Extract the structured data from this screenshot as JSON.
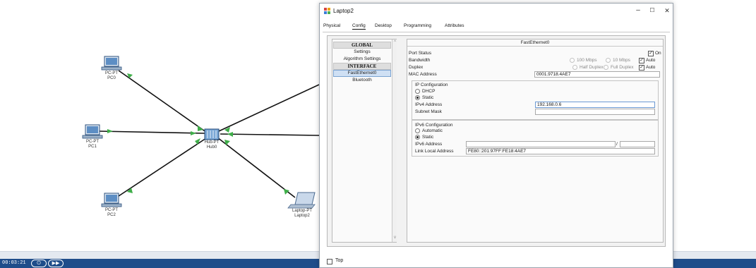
{
  "topology": {
    "devices": [
      {
        "id": "pc0",
        "type": "PC-PT",
        "name": "PC0"
      },
      {
        "id": "pc1",
        "type": "PC-PT",
        "name": "PC1"
      },
      {
        "id": "pc2",
        "type": "PC-PT",
        "name": "PC2"
      },
      {
        "id": "hub0",
        "type": "Hub-PT",
        "name": "Hub0"
      },
      {
        "id": "laptop2",
        "type": "Laptop-PT",
        "name": "Laptop2"
      }
    ],
    "link_color": "#111111",
    "link_light_color": "#3fae49"
  },
  "simbar": {
    "time": "00:03:21",
    "power_glyph": "⏻",
    "fastforward_glyph": "▶▶"
  },
  "window": {
    "title": "Laptop2",
    "controls": {
      "minimize": "–",
      "maximize": "☐",
      "close": "✕"
    },
    "tabs": [
      "Physical",
      "Config",
      "Desktop",
      "Programming",
      "Attributes"
    ],
    "active_tab": "Config",
    "left_list": {
      "items": [
        "GLOBAL",
        "Settings",
        "Algorithm Settings",
        "INTERFACE",
        "FastEthernet0",
        "Bluetooth"
      ],
      "selected": "FastEthernet0",
      "scroll_up": "^",
      "scroll_down": "v"
    },
    "panel": {
      "title": "FastEthernet0",
      "port_status": {
        "label": "Port Status",
        "on_label": "On",
        "on_checked": true
      },
      "bandwidth": {
        "label": "Bandwidth",
        "opt_100": "100 Mbps",
        "opt_10": "10 Mbps",
        "auto_label": "Auto",
        "auto_checked": true
      },
      "duplex": {
        "label": "Duplex",
        "opt_half": "Half Duplex",
        "opt_full": "Full Duplex",
        "auto_label": "Auto",
        "auto_checked": true
      },
      "mac": {
        "label": "MAC Address",
        "value": "0001.9718.4AE7"
      },
      "ip_config": {
        "heading": "IP Configuration",
        "dhcp": "DHCP",
        "static": "Static",
        "selected": "Static",
        "ipv4_label": "IPv4 Address",
        "ipv4_value": "192.168.0.6",
        "subnet_label": "Subnet Mask",
        "subnet_value": ""
      },
      "ipv6_config": {
        "heading": "IPv6 Configuration",
        "automatic": "Automatic",
        "static": "Static",
        "selected": "Static",
        "ipv6_label": "IPv6 Address",
        "ipv6_value": "",
        "prefix_sep": "/",
        "prefix_value": "",
        "link_local_label": "Link Local Address",
        "link_local_value": "FE80::201:97FF:FE18:4AE7"
      }
    },
    "bottom": {
      "top_label": "Top",
      "top_checked": false
    }
  }
}
